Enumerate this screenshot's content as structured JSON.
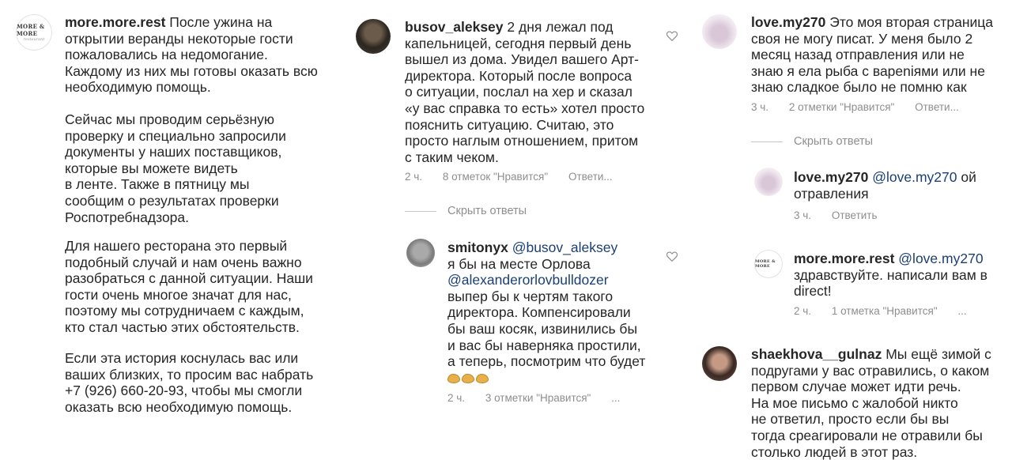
{
  "col1": {
    "username": "more.more.rest",
    "logo_main": "MORE & MORE",
    "logo_sub": "restaurant",
    "paragraph1": "После ужина на открытии веранды некоторые гости пожаловались на недомогание. Каждому из них мы готовы оказать всю необходимую помощь.",
    "paragraph2_lines": [
      "Сейчас мы проводим серьёзную",
      "проверку и специально запросили",
      "документы у наших поставщиков,",
      "которые вы можете видеть",
      "в ленте. Также в пятницу мы",
      "сообщим о результатах проверки",
      "Роспотребнадзора."
    ],
    "paragraph3_lines": [
      "Для нашего ресторана это первый",
      "подобный случай и нам очень важно",
      "разобраться с данной ситуации. Наши",
      "гости очень многое значат для нас,",
      "поэтому мы сотрудничаем с каждым,",
      "кто стал частью этих обстоятельств."
    ],
    "paragraph4_lines": [
      "Если эта история коснулась вас или",
      "ваших близких, то просим вас набрать",
      "+7 (926) 660-20-93, чтобы мы смогли",
      "оказать всю необходимую помощь."
    ]
  },
  "col2": {
    "comment1": {
      "username": "busov_aleksey",
      "lines": [
        "2 дня лежал под",
        "капельницей, сегодня первый день",
        "вышел из дома. Увидел вашего Арт-",
        "директора. Который после вопроса",
        "о ситуации, послал на хер и сказал",
        "«у вас справка то есть» хотел просто",
        "пояснить ситуацию. Считаю, это",
        "просто наглым отношением, притом",
        "с таким чеком."
      ],
      "time": "2 ч.",
      "likes": "8 отметок \"Нравится\"",
      "reply": "Ответи..."
    },
    "hide_replies": "Скрыть ответы",
    "comment2": {
      "username": "smitonyx",
      "mention1": "@busov_aleksey",
      "line2": "я бы на месте Орлова",
      "mention2": "@alexanderorlovbulldozer",
      "lines": [
        "выпер бы к чертям такого",
        "директора. Компенсировали",
        "бы ваш косяк, извинились бы",
        "и вас бы наверняка простили,",
        "а теперь, посмотрим что будет"
      ],
      "time": "2 ч.",
      "likes": "3 отметки \"Нравится\"",
      "more": "..."
    }
  },
  "col3": {
    "comment1": {
      "username": "love.my270",
      "first": "Это моя вторая страница",
      "lines": [
        "своя не могу писат. У меня было 2",
        "месяц назад отправления или не",
        "знаю я ела рыба с вареniями или не",
        "знаю сладкое было не помню как"
      ],
      "time": "3 ч.",
      "likes": "2 отметки \"Нравится\"",
      "reply": "Ответи..."
    },
    "hide_replies": "Скрыть ответы",
    "reply1": {
      "username": "love.my270",
      "mention": "@love.my270",
      "tail": "ой",
      "line2": "отравления",
      "time": "3 ч.",
      "reply": "Ответить"
    },
    "reply2": {
      "username": "more.more.rest",
      "mention": "@love.my270",
      "lines": [
        "здравствуйте. написали вам в",
        "direct!"
      ],
      "time": "2 ч.",
      "likes": "1 отметка \"Нравится\"",
      "more": "..."
    },
    "comment2": {
      "username": "shaekhova__gulnaz",
      "first": "Мы ещё зимой с",
      "lines": [
        "подругами у вас отравились, о каком",
        "первом случае может идти речь.",
        "На мое письмо с жалобой никто",
        "не ответил, просто  если бы вы",
        "тогда среагировали не отравили бы",
        "столько людей в этот раз."
      ]
    }
  },
  "colors": {
    "text": "#262626",
    "muted": "#8e8e8e",
    "mention": "#1a3f73"
  }
}
